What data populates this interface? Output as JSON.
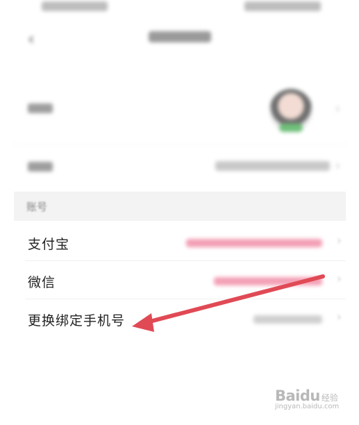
{
  "account": {
    "section_title": "账号",
    "rows": [
      {
        "label": "支付宝"
      },
      {
        "label": "微信"
      },
      {
        "label": "更换绑定手机号"
      }
    ]
  },
  "colors": {
    "pink_value": "#f3a0b5",
    "arrow": "#e04a55",
    "section_bg": "#f3f3f3"
  },
  "icons": {
    "back": "back-arrow-icon",
    "chevron": "chevron-right-icon"
  },
  "watermark": {
    "logo": "Baidu",
    "cn": "经验",
    "url": "jingyan.baidu.com"
  }
}
